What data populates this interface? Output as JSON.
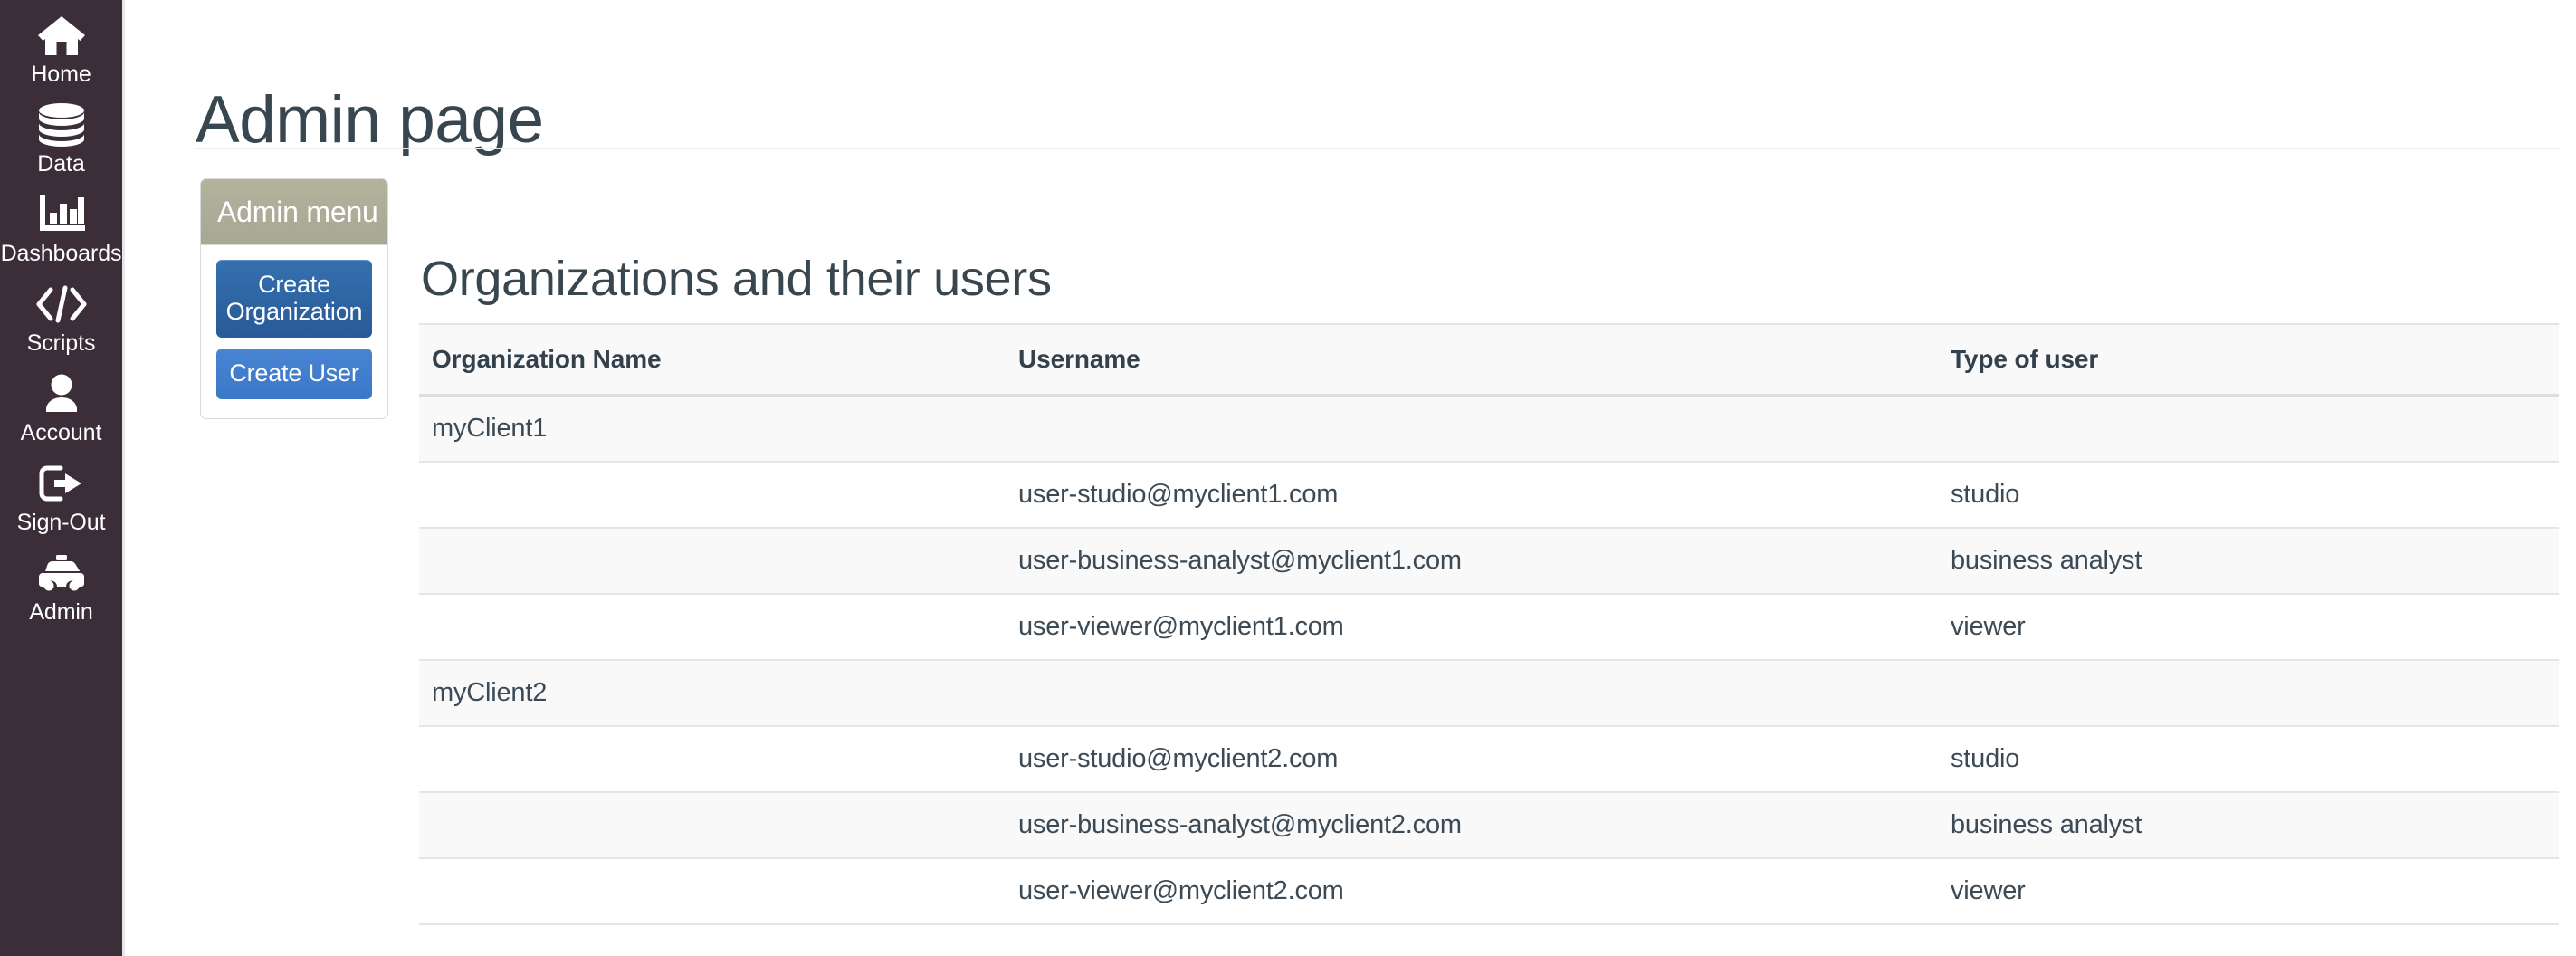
{
  "colors": {
    "sidebar_bg": "#3b2e38",
    "sidebar_text": "#ffffff",
    "panel_header_bg": "#a7a793",
    "primary_button": "#285a96",
    "secondary_button": "#3b78c8",
    "heading_text": "#384650",
    "table_stripe": "#f9f9fa",
    "table_border": "#e4e5e6"
  },
  "sidebar": {
    "items": [
      {
        "label": "Home",
        "icon": "home-icon"
      },
      {
        "label": "Data",
        "icon": "database-icon"
      },
      {
        "label": "Dashboards",
        "icon": "bar-chart-icon"
      },
      {
        "label": "Scripts",
        "icon": "code-icon"
      },
      {
        "label": "Account",
        "icon": "user-icon"
      },
      {
        "label": "Sign-Out",
        "icon": "sign-out-icon"
      },
      {
        "label": "Admin",
        "icon": "taxi-icon"
      }
    ]
  },
  "page": {
    "title": "Admin page"
  },
  "admin_menu": {
    "title": "Admin menu",
    "buttons": [
      {
        "label": "Create Organization"
      },
      {
        "label": "Create User"
      }
    ]
  },
  "orgs_section": {
    "heading": "Organizations and their users",
    "columns": [
      "Organization Name",
      "Username",
      "Type of user"
    ],
    "rows": [
      {
        "org": "myClient1",
        "username": "",
        "type": ""
      },
      {
        "org": "",
        "username": "user-studio@myclient1.com",
        "type": "studio"
      },
      {
        "org": "",
        "username": "user-business-analyst@myclient1.com",
        "type": "business analyst"
      },
      {
        "org": "",
        "username": "user-viewer@myclient1.com",
        "type": "viewer"
      },
      {
        "org": "myClient2",
        "username": "",
        "type": ""
      },
      {
        "org": "",
        "username": "user-studio@myclient2.com",
        "type": "studio"
      },
      {
        "org": "",
        "username": "user-business-analyst@myclient2.com",
        "type": "business analyst"
      },
      {
        "org": "",
        "username": "user-viewer@myclient2.com",
        "type": "viewer"
      }
    ]
  }
}
